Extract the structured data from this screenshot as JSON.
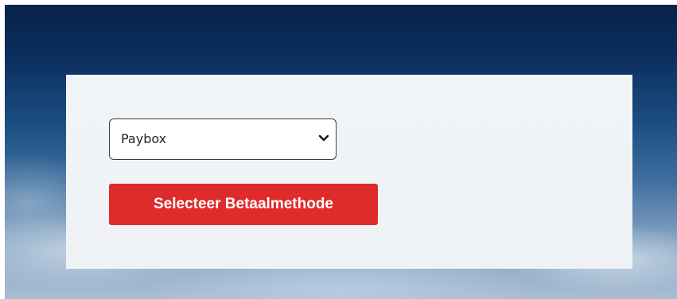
{
  "form": {
    "payment_select": {
      "selected_value": "Paybox"
    },
    "submit_label": "Selecteer Betaalmethode"
  },
  "colors": {
    "button_background": "#e02b2b",
    "card_background": "#eef2f5",
    "sky_top": "#08224a"
  },
  "icons": {
    "select_arrow": "chevron-down-icon"
  }
}
